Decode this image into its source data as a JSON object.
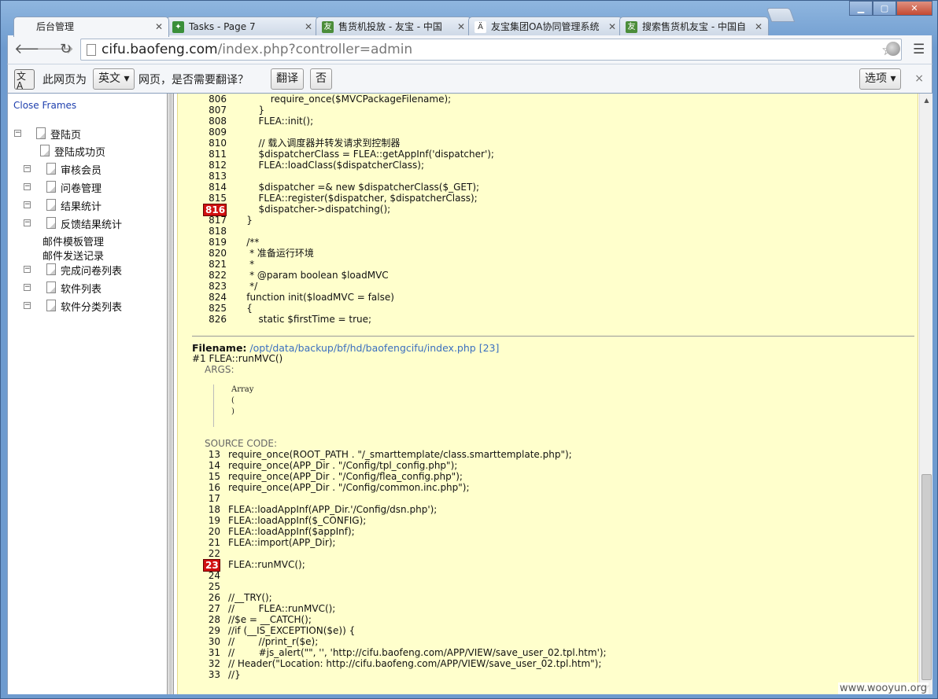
{
  "tabs": [
    {
      "label": "后台管理",
      "fav": "",
      "fav_color": "#f4f6f9",
      "active": true
    },
    {
      "label": "Tasks - Page 7",
      "fav": "✦",
      "fav_color": "#3a8f3a"
    },
    {
      "label": "售货机投放 - 友宝 - 中国",
      "fav": "友",
      "fav_color": "#4b8d3a"
    },
    {
      "label": "友宝集团OA协同管理系统",
      "fav": "Ä",
      "fav_color": "#ffffff"
    },
    {
      "label": "搜索售货机友宝 - 中国自",
      "fav": "友",
      "fav_color": "#4b8d3a"
    }
  ],
  "window_controls": {
    "minimize": "▁",
    "maximize": "▢",
    "close": "✕"
  },
  "address": {
    "domain": "cifu.baofeng.com",
    "path": "/index.php?controller=admin"
  },
  "translate_bar": {
    "icon": "文A",
    "prefix": "此网页为",
    "language": "英文 ▾",
    "suffix": "网页，是否需要翻译？",
    "translate": "翻译",
    "no": "否",
    "options": "选项 ▾",
    "close": "×"
  },
  "sidebar": {
    "close_frames": "Close Frames",
    "items": [
      {
        "label": "登陆页",
        "minus": "⊟"
      },
      {
        "label": "登陆成功页"
      },
      {
        "label": "审核会员",
        "minus": "⊟"
      },
      {
        "label": "问卷管理",
        "minus": "⊟"
      },
      {
        "label": "结果统计",
        "minus": "⊟"
      },
      {
        "label": "反馈结果统计",
        "minus": "⊟"
      },
      {
        "label": "邮件模板管理"
      },
      {
        "label": "邮件发送记录"
      },
      {
        "label": "完成问卷列表",
        "minus": "⊟"
      },
      {
        "label": "软件列表",
        "minus": "⊟"
      },
      {
        "label": "软件分类列表",
        "minus": "⊟"
      }
    ]
  },
  "code_top": [
    {
      "n": "806",
      "code": "            require_once($MVCPackageFilename);"
    },
    {
      "n": "807",
      "code": "        }"
    },
    {
      "n": "808",
      "code": "        FLEA::init();"
    },
    {
      "n": "809",
      "code": ""
    },
    {
      "n": "810",
      "code": "        // 载入调度器并转发请求到控制器"
    },
    {
      "n": "811",
      "code": "        $dispatcherClass = FLEA::getAppInf('dispatcher');"
    },
    {
      "n": "812",
      "code": "        FLEA::loadClass($dispatcherClass);"
    },
    {
      "n": "813",
      "code": ""
    },
    {
      "n": "814",
      "code": "        $dispatcher =& new $dispatcherClass($_GET);"
    },
    {
      "n": "815",
      "code": "        FLEA::register($dispatcher, $dispatcherClass);"
    },
    {
      "n": "816",
      "code": "        $dispatcher->dispatching();",
      "hl": true
    },
    {
      "n": "817",
      "code": "    }"
    },
    {
      "n": "818",
      "code": ""
    },
    {
      "n": "819",
      "code": "    /**"
    },
    {
      "n": "820",
      "code": "     * 准备运行环境"
    },
    {
      "n": "821",
      "code": "     *"
    },
    {
      "n": "822",
      "code": "     * @param boolean $loadMVC"
    },
    {
      "n": "823",
      "code": "     */"
    },
    {
      "n": "824",
      "code": "    function init($loadMVC = false)"
    },
    {
      "n": "825",
      "code": "    {"
    },
    {
      "n": "826",
      "code": "        static $firstTime = true;"
    }
  ],
  "trace": {
    "filename_label": "Filename:",
    "filename_path": "/opt/data/backup/bf/hd/baofengcifu/index.php [23]",
    "call": "#1 FLEA::runMVC()",
    "args_label": "ARGS:",
    "args_lines": [
      "Array",
      "(",
      ")"
    ],
    "source_label": "SOURCE CODE:"
  },
  "code_bottom": [
    {
      "n": "13",
      "code": "require_once(ROOT_PATH . \"/_smarttemplate/class.smarttemplate.php\");"
    },
    {
      "n": "14",
      "code": "require_once(APP_Dir . \"/Config/tpl_config.php\");"
    },
    {
      "n": "15",
      "code": "require_once(APP_Dir . \"/Config/flea_config.php\");"
    },
    {
      "n": "16",
      "code": "require_once(APP_Dir . \"/Config/common.inc.php\");"
    },
    {
      "n": "17",
      "code": ""
    },
    {
      "n": "18",
      "code": "FLEA::loadAppInf(APP_Dir.'/Config/dsn.php');"
    },
    {
      "n": "19",
      "code": "FLEA::loadAppInf($_CONFIG);"
    },
    {
      "n": "20",
      "code": "FLEA::loadAppInf($appInf);"
    },
    {
      "n": "21",
      "code": "FLEA::import(APP_Dir);"
    },
    {
      "n": "22",
      "code": ""
    },
    {
      "n": "23",
      "code": "FLEA::runMVC();",
      "hl": true
    },
    {
      "n": "24",
      "code": ""
    },
    {
      "n": "25",
      "code": ""
    },
    {
      "n": "26",
      "code": "//__TRY();"
    },
    {
      "n": "27",
      "code": "//        FLEA::runMVC();"
    },
    {
      "n": "28",
      "code": "//$e = __CATCH();"
    },
    {
      "n": "29",
      "code": "//if (__IS_EXCEPTION($e)) {"
    },
    {
      "n": "30",
      "code": "//        //print_r($e);"
    },
    {
      "n": "31",
      "code": "//        #js_alert(\"\", '', 'http://cifu.baofeng.com/APP/VIEW/save_user_02.tpl.htm');"
    },
    {
      "n": "32",
      "code": "// Header(\"Location: http://cifu.baofeng.com/APP/VIEW/save_user_02.tpl.htm\");"
    },
    {
      "n": "33",
      "code": "//}"
    }
  ],
  "watermark": "www.wooyun.org"
}
